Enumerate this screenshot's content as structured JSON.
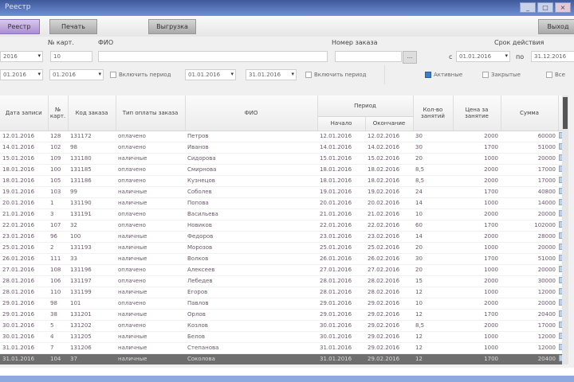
{
  "window": {
    "title": "Реестр"
  },
  "toolbar": {
    "tabs": [
      "Реестр",
      "Печать",
      "Выгрузка"
    ],
    "right_button": "Выход"
  },
  "filters": {
    "num_label": "№ карт.",
    "num_value": "10",
    "fio_label": "ФИО",
    "fio_value": "",
    "order_label": "Номер заказа",
    "order_value": "",
    "order_btn": "...",
    "period_label": "Срок действия",
    "from_label": "с",
    "from_value": "01.01.2016",
    "to_label": "по",
    "to_value": "31.12.2016",
    "year_value": "2016",
    "month_value": "01.2016",
    "date1": "01.01.2016",
    "date2": "31.01.2016",
    "chk1": "Включить период",
    "chk2": "Включить период",
    "opt1": "Активные",
    "opt2": "Закрытые",
    "opt3": "Все"
  },
  "table": {
    "headers": [
      "Дата записи",
      "№ карт.",
      "Код заказа",
      "Тип оплаты заказа",
      "ФИО",
      "Период",
      "Кол-во занятий",
      "Цена за занятие",
      "Сумма"
    ],
    "period_sub": [
      "Начало",
      "Окончание"
    ],
    "rows": [
      [
        "12.01.2016",
        "128",
        "131172",
        "оплачено",
        "Петров",
        "12.01.2016",
        "12.02.2016",
        "30",
        "2000",
        "60000"
      ],
      [
        "14.01.2016",
        "102",
        "98",
        "оплачено",
        "Иванов",
        "14.01.2016",
        "14.02.2016",
        "30",
        "1700",
        "51000"
      ],
      [
        "15.01.2016",
        "109",
        "131180",
        "наличные",
        "Сидорова",
        "15.01.2016",
        "15.02.2016",
        "20",
        "1000",
        "20000"
      ],
      [
        "18.01.2016",
        "100",
        "131185",
        "оплачено",
        "Смирнова",
        "18.01.2016",
        "18.02.2016",
        "8,5",
        "2000",
        "17000"
      ],
      [
        "18.01.2016",
        "105",
        "131186",
        "оплачено",
        "Кузнецов",
        "18.01.2016",
        "18.02.2016",
        "8,5",
        "2000",
        "17000"
      ],
      [
        "19.01.2016",
        "103",
        "99",
        "наличные",
        "Соболев",
        "19.01.2016",
        "19.02.2016",
        "24",
        "1700",
        "40800"
      ],
      [
        "20.01.2016",
        "1",
        "131190",
        "наличные",
        "Попова",
        "20.01.2016",
        "20.02.2016",
        "14",
        "1000",
        "14000"
      ],
      [
        "21.01.2016",
        "3",
        "131191",
        "оплачено",
        "Васильева",
        "21.01.2016",
        "21.02.2016",
        "10",
        "2000",
        "20000"
      ],
      [
        "22.01.2016",
        "107",
        "32",
        "оплачено",
        "Новиков",
        "22.01.2016",
        "22.02.2016",
        "60",
        "1700",
        "102000"
      ],
      [
        "23.01.2016",
        "96",
        "100",
        "наличные",
        "Федоров",
        "23.01.2016",
        "23.02.2016",
        "14",
        "2000",
        "28000"
      ],
      [
        "25.01.2016",
        "2",
        "131193",
        "наличные",
        "Морозов",
        "25.01.2016",
        "25.02.2016",
        "20",
        "1000",
        "20000"
      ],
      [
        "26.01.2016",
        "111",
        "33",
        "наличные",
        "Волков",
        "26.01.2016",
        "26.02.2016",
        "30",
        "1700",
        "51000"
      ],
      [
        "27.01.2016",
        "108",
        "131196",
        "оплачено",
        "Алексеев",
        "27.01.2016",
        "27.02.2016",
        "20",
        "1000",
        "20000"
      ],
      [
        "28.01.2016",
        "106",
        "131197",
        "оплачено",
        "Лебедев",
        "28.01.2016",
        "28.02.2016",
        "15",
        "2000",
        "30000"
      ],
      [
        "28.01.2016",
        "110",
        "131199",
        "наличные",
        "Егоров",
        "28.01.2016",
        "28.02.2016",
        "12",
        "1000",
        "12000"
      ],
      [
        "29.01.2016",
        "98",
        "101",
        "оплачено",
        "Павлов",
        "29.01.2016",
        "29.02.2016",
        "10",
        "2000",
        "20000"
      ],
      [
        "29.01.2016",
        "38",
        "131201",
        "наличные",
        "Орлов",
        "29.01.2016",
        "29.02.2016",
        "12",
        "1700",
        "20400"
      ],
      [
        "30.01.2016",
        "5",
        "131202",
        "оплачено",
        "Козлов",
        "30.01.2016",
        "29.02.2016",
        "8,5",
        "2000",
        "17000"
      ],
      [
        "30.01.2016",
        "4",
        "131205",
        "наличные",
        "Белов",
        "30.01.2016",
        "29.02.2016",
        "12",
        "1000",
        "12000"
      ],
      [
        "31.01.2016",
        "7",
        "131206",
        "наличные",
        "Степанова",
        "31.01.2016",
        "29.02.2016",
        "12",
        "1000",
        "12000"
      ],
      [
        "31.01.2016",
        "104",
        "37",
        "наличные",
        "Соколова",
        "31.01.2016",
        "29.02.2016",
        "12",
        "1700",
        "20400"
      ]
    ],
    "selected_row": 20
  }
}
